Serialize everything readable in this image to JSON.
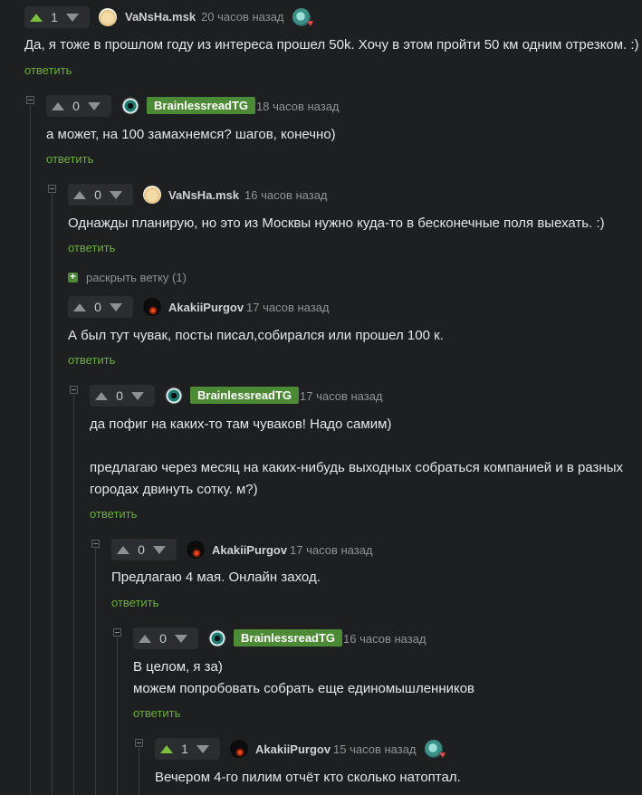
{
  "comments": [
    {
      "score": "1",
      "author": "VaNsHa.msk",
      "time": "20 часов назад",
      "lines": [
        "Да, я тоже в прошлом году из интереса прошел 50k. Хочу в этом пройти 50 км одним отрезком. :)"
      ],
      "reply": "ответить"
    },
    {
      "score": "0",
      "author": "BrainlessreadTG",
      "time": "18 часов назад",
      "lines": [
        "а может, на 100 замахнемся? шагов, конечно)"
      ],
      "reply": "ответить"
    },
    {
      "score": "0",
      "author": "VaNsHa.msk",
      "time": "16 часов назад",
      "lines": [
        "Однажды планирую, но это из Москвы нужно куда-то в бесконечные поля выехать. :)"
      ],
      "reply": "ответить"
    },
    {
      "score": "0",
      "author": "AkakiiPurgov",
      "time": "17 часов назад",
      "lines": [
        "А был тут чувак, посты писал,собирался или прошел 100 к."
      ],
      "reply": "ответить"
    },
    {
      "score": "0",
      "author": "BrainlessreadTG",
      "time": "17 часов назад",
      "lines": [
        "да пофиг на каких-то там чуваков! Надо самим)",
        "",
        "предлагаю через месяц на каких-нибудь выходных собраться компанией и в разных",
        "городах двинуть сотку. м?)"
      ],
      "reply": "ответить"
    },
    {
      "score": "0",
      "author": "AkakiiPurgov",
      "time": "17 часов назад",
      "lines": [
        "Предлагаю 4 мая. Онлайн заход."
      ],
      "reply": "ответить"
    },
    {
      "score": "0",
      "author": "BrainlessreadTG",
      "time": "16 часов назад",
      "lines": [
        "В целом, я за)",
        "можем попробовать собрать еще единомышленников"
      ],
      "reply": "ответить"
    },
    {
      "score": "1",
      "author": "AkakiiPurgov",
      "time": "15 часов назад",
      "lines": [
        "Вечером 4-го пилим отчёт кто сколько натоптал."
      ],
      "reply": ""
    }
  ],
  "expand_branch": {
    "label": "раскрыть ветку (1)",
    "icon": "+"
  },
  "colors": {
    "background": "#1e1f21",
    "accent_green": "#6cae3c",
    "badge_green": "#4d8a35",
    "upvote_active": "#7bbf3a"
  },
  "icons": [
    "upvote-icon",
    "downvote-icon",
    "collapse-icon",
    "avatar",
    "award-icon",
    "expand-icon"
  ]
}
